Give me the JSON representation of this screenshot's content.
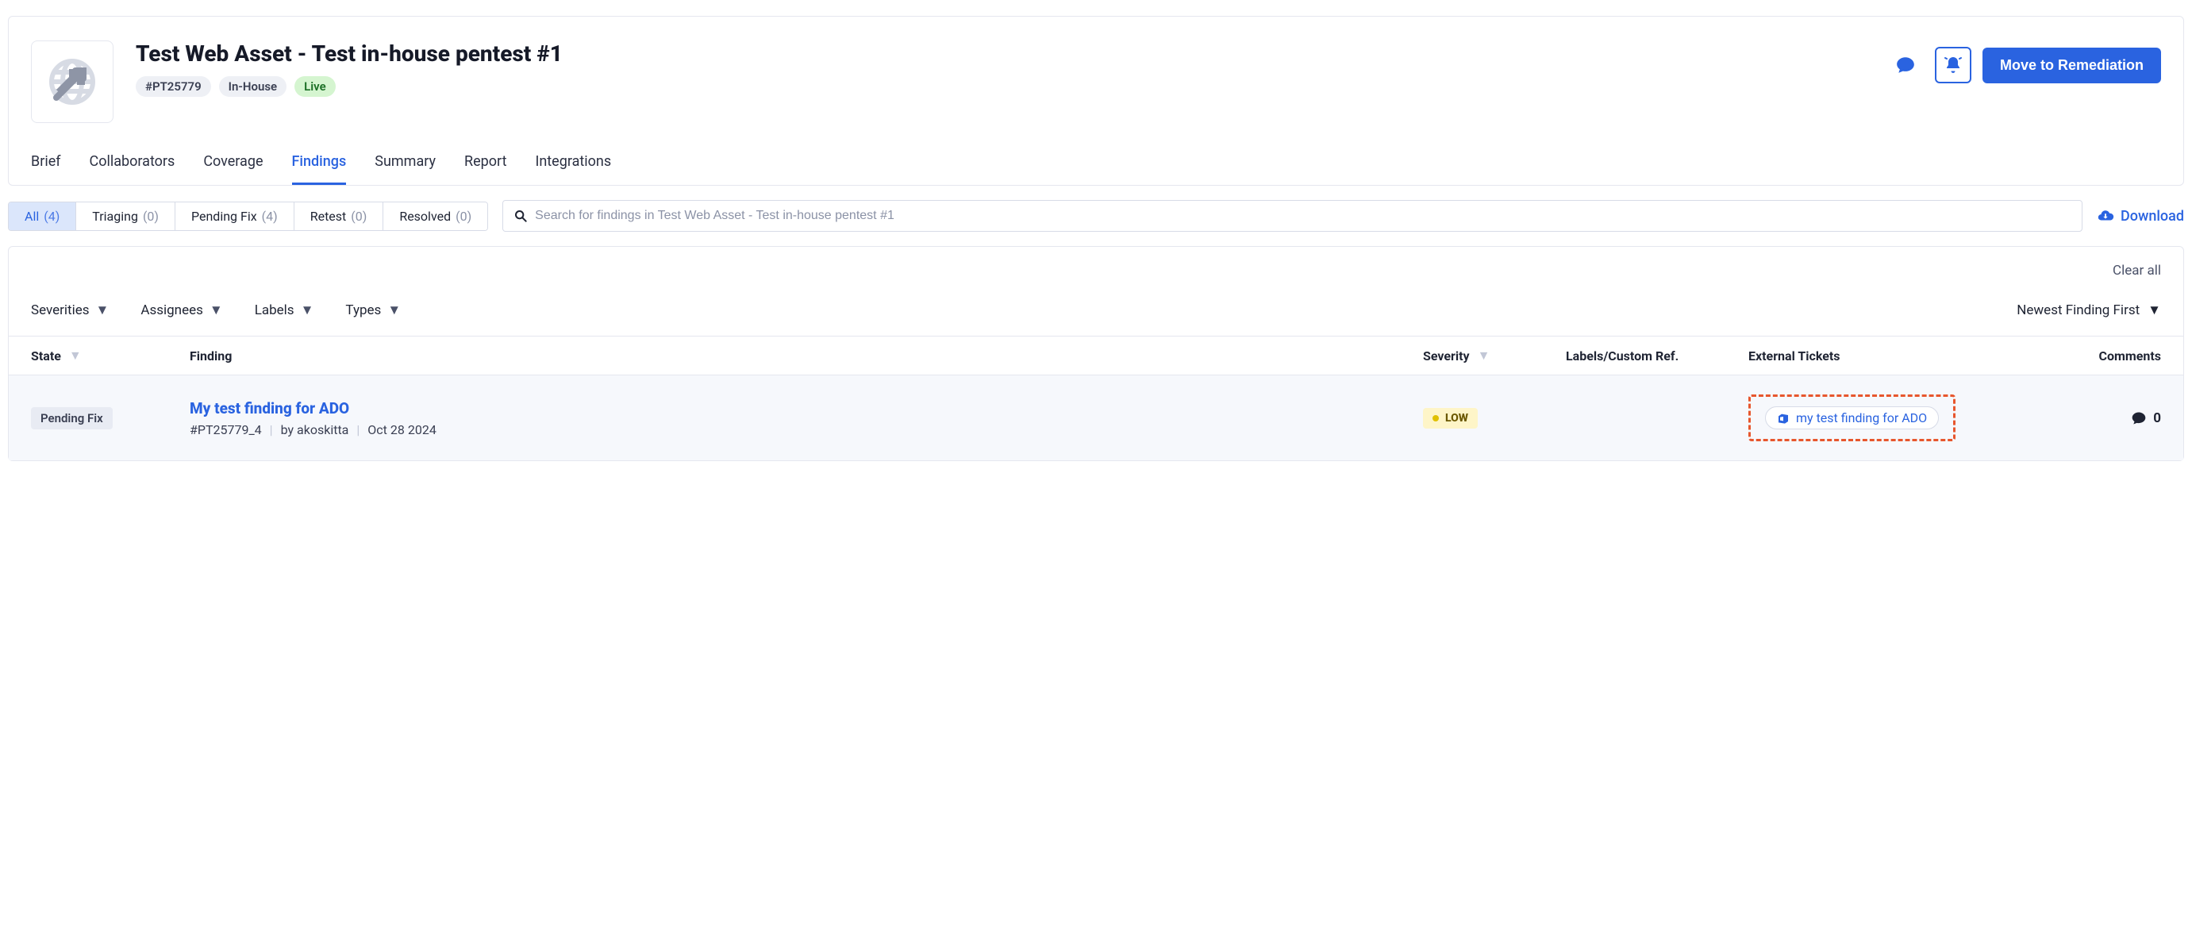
{
  "header": {
    "title": "Test Web Asset - Test in-house pentest #1",
    "id_badge": "#PT25779",
    "scope_badge": "In-House",
    "status_badge": "Live",
    "primary_action": "Move to Remediation"
  },
  "tabs": [
    {
      "label": "Brief",
      "active": false
    },
    {
      "label": "Collaborators",
      "active": false
    },
    {
      "label": "Coverage",
      "active": false
    },
    {
      "label": "Findings",
      "active": true
    },
    {
      "label": "Summary",
      "active": false
    },
    {
      "label": "Report",
      "active": false
    },
    {
      "label": "Integrations",
      "active": false
    }
  ],
  "status_filters": [
    {
      "label": "All",
      "count": "(4)",
      "active": true
    },
    {
      "label": "Triaging",
      "count": "(0)",
      "active": false
    },
    {
      "label": "Pending Fix",
      "count": "(4)",
      "active": false
    },
    {
      "label": "Retest",
      "count": "(0)",
      "active": false
    },
    {
      "label": "Resolved",
      "count": "(0)",
      "active": false
    }
  ],
  "search": {
    "placeholder": "Search for findings in Test Web Asset - Test in-house pentest #1"
  },
  "download_label": "Download",
  "clear_all_label": "Clear all",
  "dropdown_filters": [
    "Severities",
    "Assignees",
    "Labels",
    "Types"
  ],
  "sort_label": "Newest Finding First",
  "columns": {
    "state": "State",
    "finding": "Finding",
    "severity": "Severity",
    "labels": "Labels/Custom Ref.",
    "tickets": "External Tickets",
    "comments": "Comments"
  },
  "rows": [
    {
      "state": "Pending Fix",
      "title": "My test finding for ADO",
      "id": "#PT25779_4",
      "author_prefix": "by ",
      "author": "akoskitta",
      "date": "Oct 28 2024",
      "severity": "LOW",
      "ticket_label": "my test finding for ADO",
      "comments": "0"
    }
  ]
}
